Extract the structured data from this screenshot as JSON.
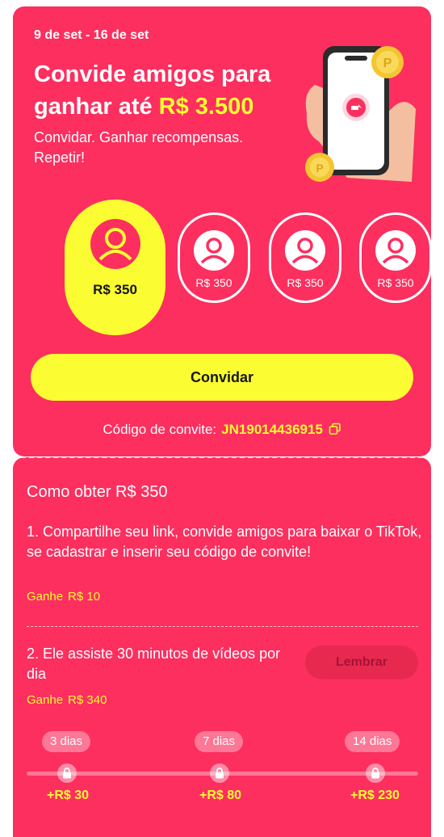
{
  "header": {
    "date_range": "9 de set - 16 de set",
    "title_line1": "Convide amigos para",
    "title_line2": "ganhar até",
    "title_amount": "R$ 3.500",
    "subtitle": "Convidar. Ganhar recompensas. Repetir!"
  },
  "slots": [
    {
      "label": "R$ 350",
      "state": "active"
    },
    {
      "label": "R$ 350",
      "state": "locked"
    },
    {
      "label": "R$ 350",
      "state": "locked"
    },
    {
      "label": "R$ 350",
      "state": "locked"
    }
  ],
  "invite_button": "Convidar",
  "invite_code": {
    "label": "Código de convite:",
    "code": "JN19014436915",
    "icon": "copy-icon"
  },
  "how_to": {
    "title": "Como obter R$ 350",
    "step1": "1. Compartilhe seu link, convide amigos para baixar o TikTok, se cadastrar e inserir seu código de convite!",
    "step1_earn_label": "Ganhe",
    "step1_earn_value": "R$ 10",
    "step2": "2. Ele assiste 30 minutos de vídeos por dia",
    "step2_earn_label": "Ganhe",
    "step2_earn_value": "R$ 340",
    "remind_button": "Lembrar"
  },
  "milestones": [
    {
      "days": "3 dias",
      "reward": "+R$ 30"
    },
    {
      "days": "7 dias",
      "reward": "+R$ 80"
    },
    {
      "days": "14 dias",
      "reward": "+R$ 230"
    }
  ],
  "colors": {
    "background": "#fc2f5f",
    "accent": "#fcfc33"
  }
}
